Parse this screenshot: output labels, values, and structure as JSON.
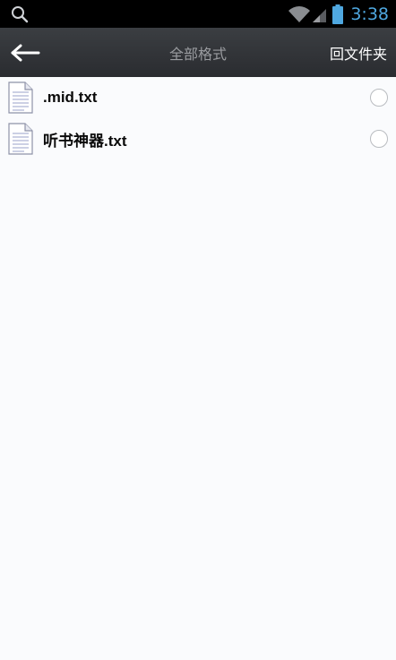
{
  "status_bar": {
    "time": "3:38",
    "icons": [
      "search-icon",
      "wifi-icon",
      "signal-icon",
      "battery-icon"
    ]
  },
  "toolbar": {
    "title": "全部格式",
    "back_icon": "back-arrow-icon",
    "folder_button_label": "回文件夹"
  },
  "files": [
    {
      "name": ".mid.txt",
      "icon": "text-file-icon",
      "selected": false
    },
    {
      "name": "听书神器.txt",
      "icon": "text-file-icon",
      "selected": false
    }
  ],
  "colors": {
    "status_bar_bg": "#000000",
    "clock": "#4fa8e0",
    "toolbar_bg": "#33363a",
    "title_text": "#9a9ca0",
    "list_bg": "#fafbfd"
  }
}
